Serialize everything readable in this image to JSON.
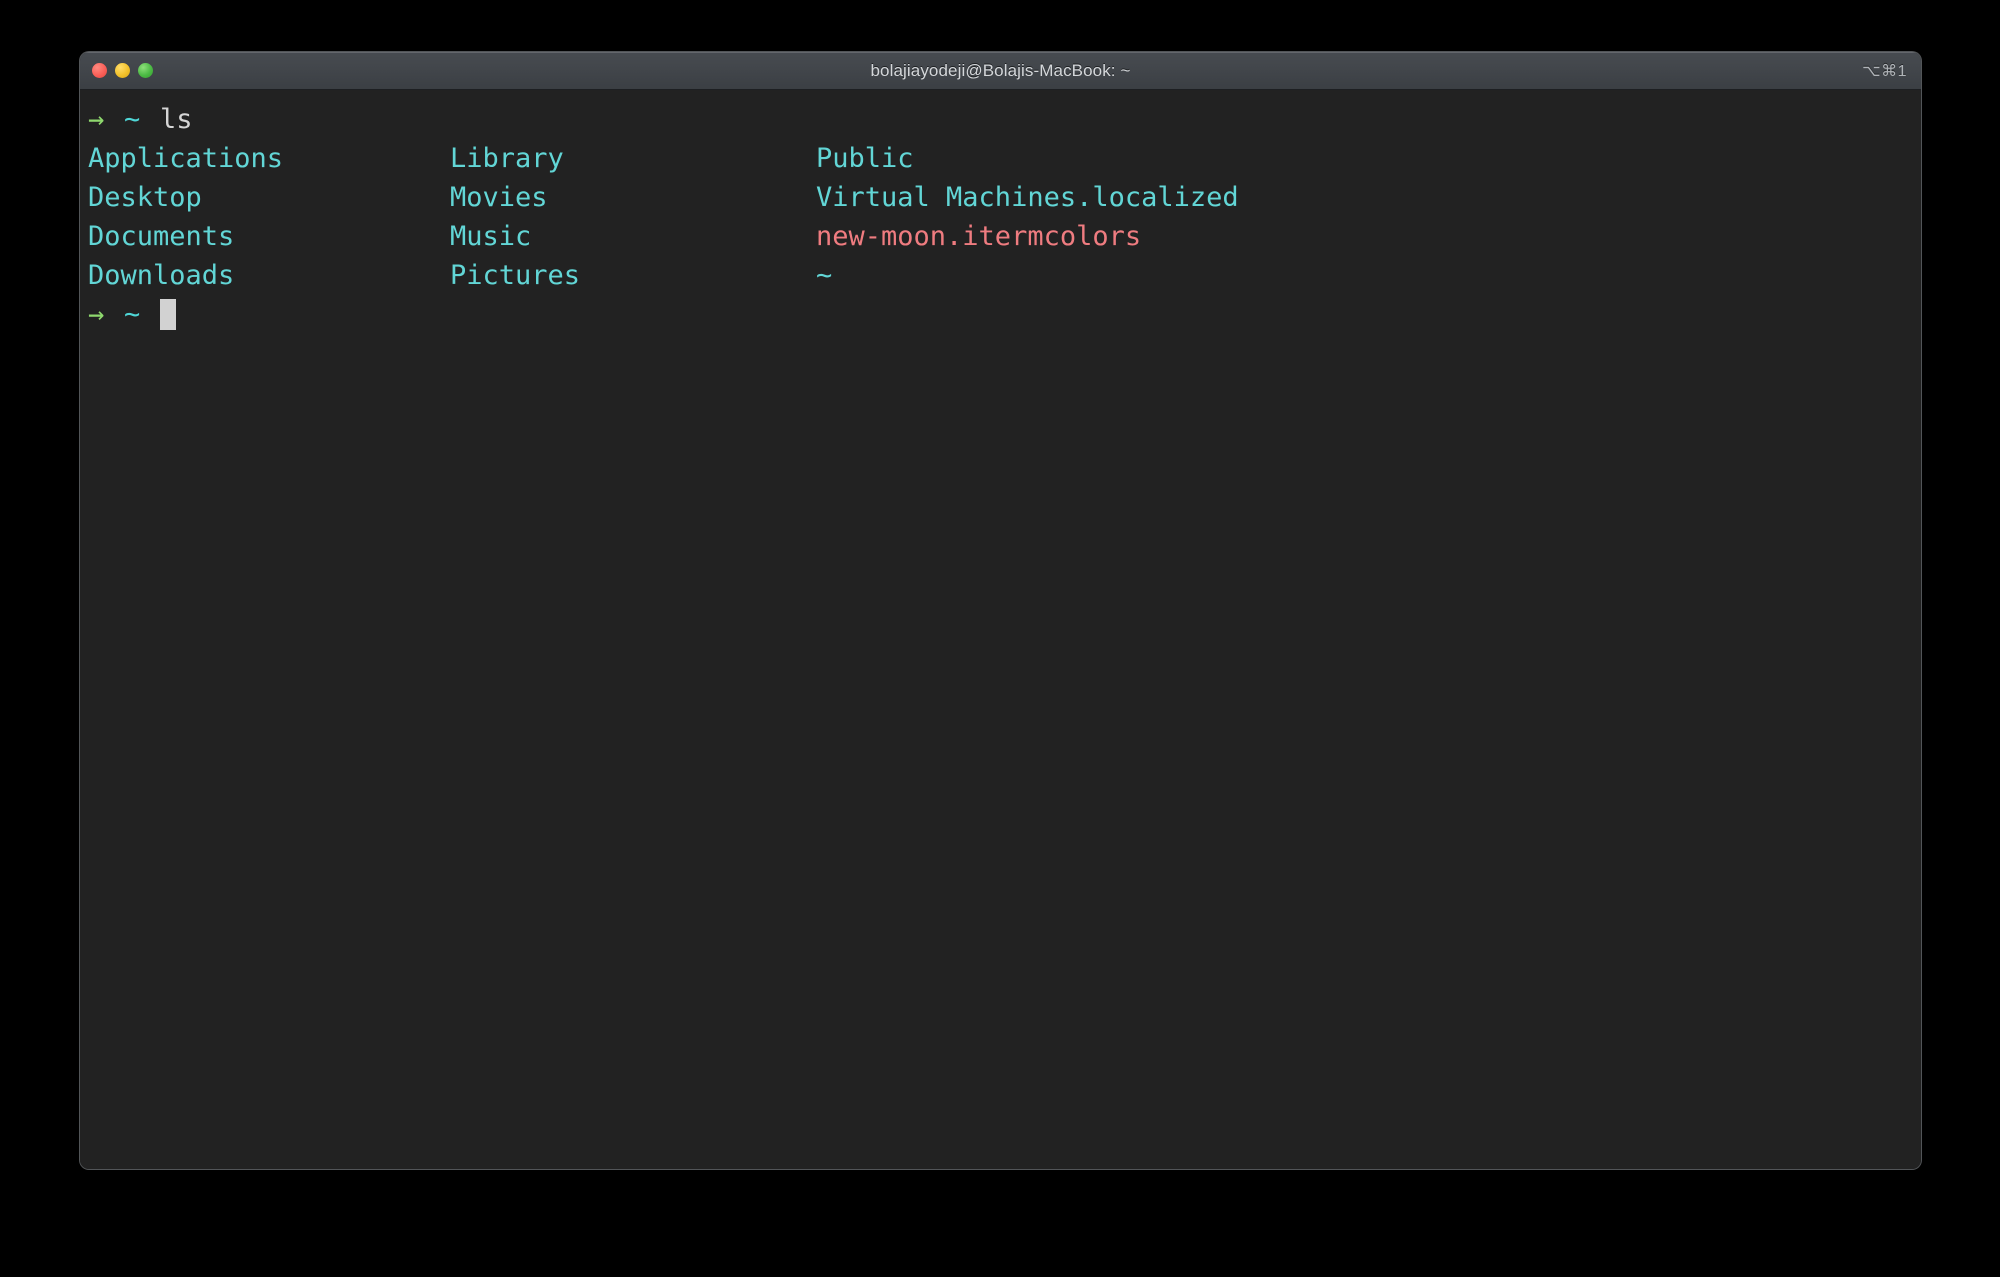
{
  "window": {
    "title": "bolajiayodeji@Bolajis-MacBook: ~",
    "shortcut_badge": "⌥⌘1",
    "traffic_lights": {
      "close_label": "Close",
      "minimize_label": "Minimize",
      "zoom_label": "Zoom"
    },
    "colors": {
      "titlebar_bg": "#42464b",
      "terminal_bg": "#222222",
      "outer_bg": "#000000",
      "close": "#fa5f58",
      "minimize": "#f2c12b",
      "zoom": "#4bb944",
      "dir_cyan": "#62d6d6",
      "file_red": "#ef7c80",
      "prompt_green": "#8fd96e",
      "prompt_cyan": "#4fd6d6",
      "command_white": "#d6d6d6",
      "cursor": "#d2d2d2"
    }
  },
  "terminal": {
    "prompt": {
      "arrow": "→",
      "path": "~",
      "command": "ls"
    },
    "output_columns": {
      "column1": [
        "Applications",
        "Desktop",
        "Documents",
        "Downloads"
      ],
      "column2": [
        "Library",
        "Movies",
        "Music",
        "Pictures"
      ],
      "column3": [
        "Public",
        "Virtual Machines.localized",
        "new-moon.itermcolors",
        "~"
      ]
    },
    "output_rows": [
      {
        "c1": "Applications",
        "c2": "Library",
        "c3": "Public",
        "c3_type": "dir"
      },
      {
        "c1": "Desktop",
        "c2": "Movies",
        "c3": "Virtual Machines.localized",
        "c3_type": "dir"
      },
      {
        "c1": "Documents",
        "c2": "Music",
        "c3": "new-moon.itermcolors",
        "c3_type": "file"
      },
      {
        "c1": "Downloads",
        "c2": "Pictures",
        "c3": "~",
        "c3_type": "dir"
      }
    ],
    "final_prompt": {
      "arrow": "→",
      "path": "~",
      "cursor": ""
    }
  }
}
